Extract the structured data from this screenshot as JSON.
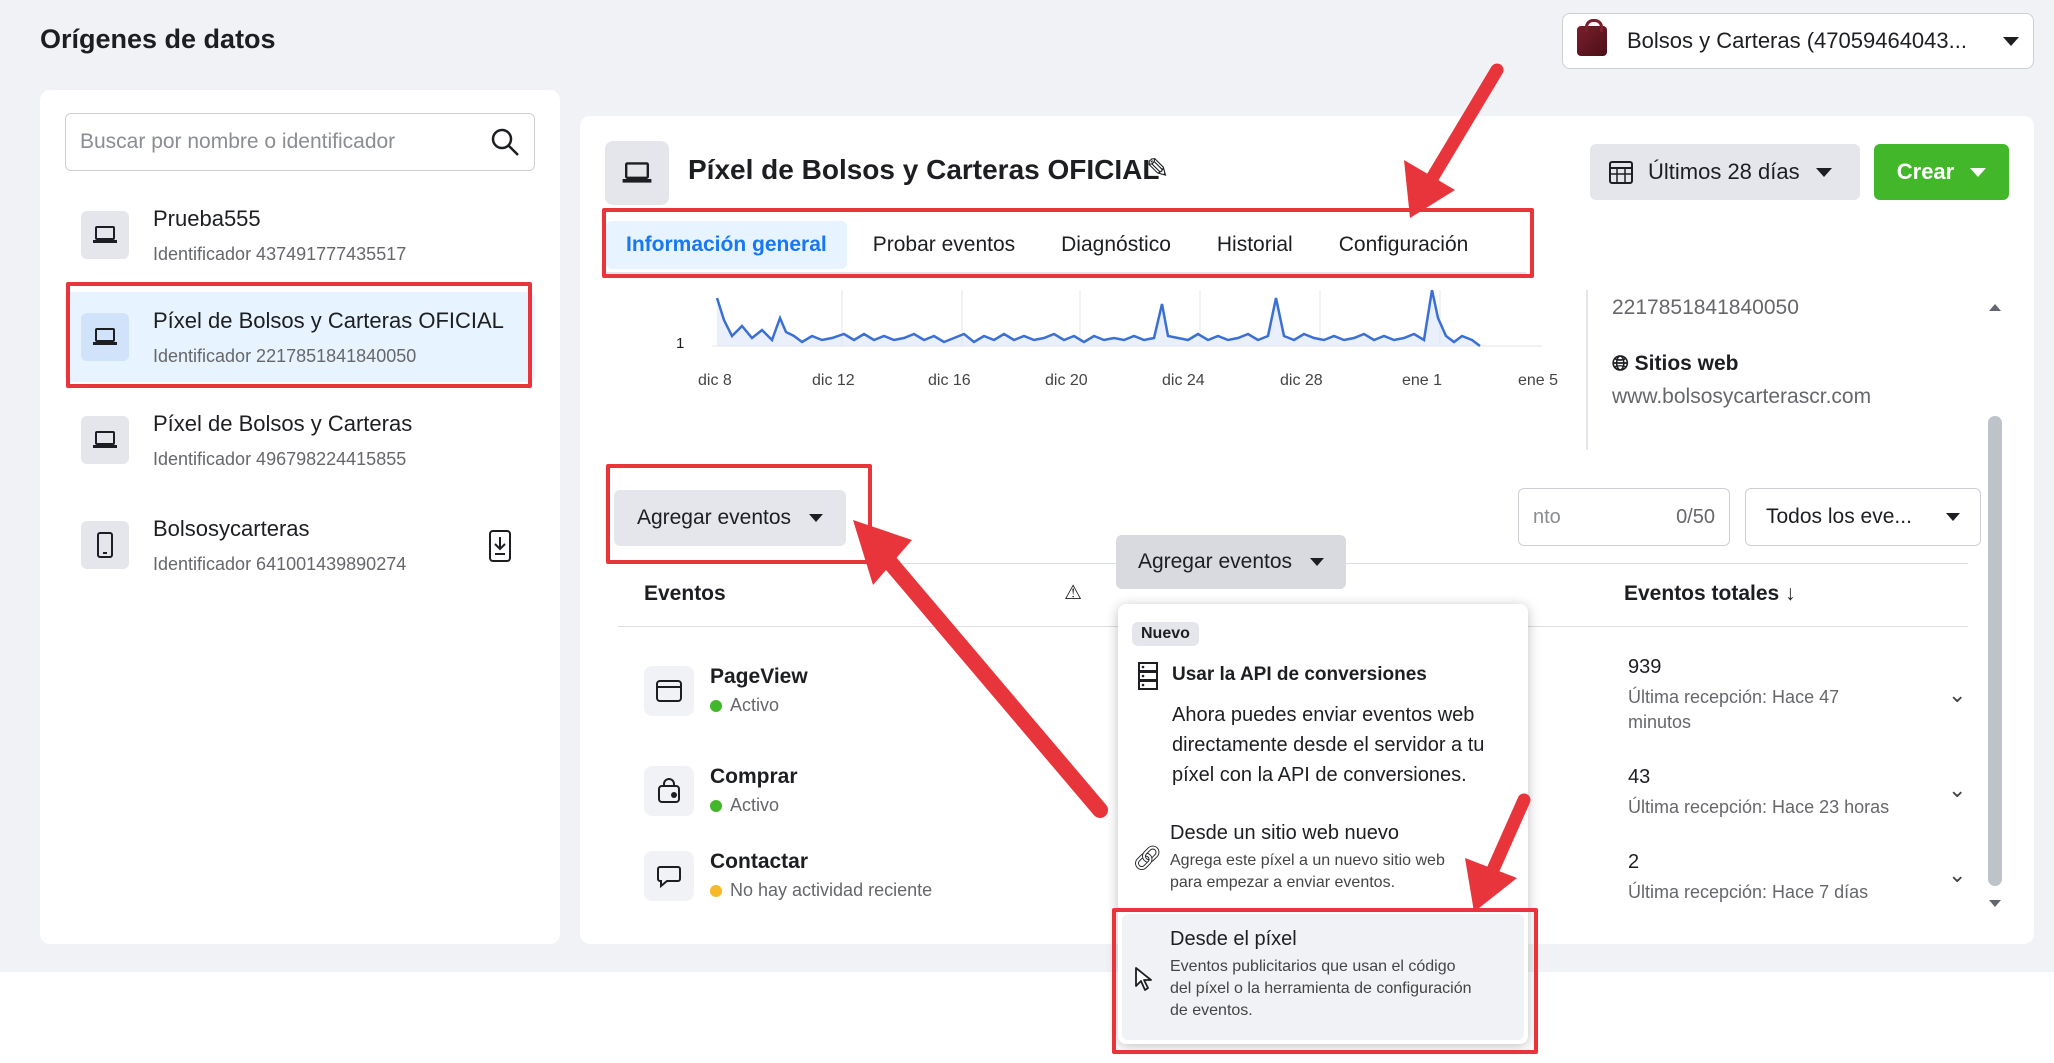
{
  "page": {
    "title": "Orígenes de datos"
  },
  "account": {
    "name": "Bolsos y Carteras (47059464043..."
  },
  "search": {
    "placeholder": "Buscar por nombre o identificador"
  },
  "sources": [
    {
      "name": "Prueba555",
      "id": "Identificador 437491777435517"
    },
    {
      "name": "Píxel de Bolsos y Carteras OFICIAL",
      "id": "Identificador 2217851841840050"
    },
    {
      "name": "Píxel de Bolsos y Carteras",
      "id": "Identificador 496798224415855"
    },
    {
      "name": "Bolsosycarteras",
      "id": "Identificador 641001439890274"
    }
  ],
  "pixel": {
    "title": "Píxel de Bolsos y Carteras OFICIAL",
    "id": "2217851841840050"
  },
  "toolbar": {
    "date_range": "Últimos 28 días",
    "create": "Crear"
  },
  "tabs": [
    {
      "label": "Información general"
    },
    {
      "label": "Probar eventos"
    },
    {
      "label": "Diagnóstico"
    },
    {
      "label": "Historial"
    },
    {
      "label": "Configuración"
    }
  ],
  "chart": {
    "ytick": "1",
    "xticks": [
      "dic 8",
      "dic 12",
      "dic 16",
      "dic 20",
      "dic 24",
      "dic 28",
      "ene 1",
      "ene 5"
    ]
  },
  "sites": {
    "heading": "Sitios web",
    "url": "www.bolsosycarterascr.com"
  },
  "events_toolbar": {
    "add_events": "Agregar eventos",
    "search_fragment": "nto",
    "counter": "0/50",
    "filter": "Todos los eve..."
  },
  "table": {
    "col_events": "Eventos",
    "col_total": "Eventos totales ↓"
  },
  "events": [
    {
      "name": "PageView",
      "status": "Activo",
      "status_color": "#42b72a",
      "total": "939",
      "last": "Última recepción: Hace 47 minutos"
    },
    {
      "name": "Comprar",
      "status": "Activo",
      "status_color": "#42b72a",
      "total": "43",
      "last": "Última recepción: Hace 23 horas"
    },
    {
      "name": "Contactar",
      "status": "No hay actividad reciente",
      "status_color": "#f7b928",
      "total": "2",
      "last": "Última recepción: Hace 7 días"
    }
  ],
  "dropdown": {
    "button": "Agregar eventos",
    "badge": "Nuevo",
    "api_title": "Usar la API de conversiones",
    "api_body": [
      "Ahora puedes enviar eventos web",
      "directamente desde el servidor a tu",
      "píxel con la API de conversiones."
    ],
    "website_title": "Desde un sitio web nuevo",
    "website_desc": [
      "Agrega este píxel a un nuevo sitio web",
      "para empezar a enviar eventos."
    ],
    "pixel_title": "Desde el píxel",
    "pixel_desc": [
      "Eventos publicitarios que usan el código",
      "del píxel o la herramienta de configuración",
      "de eventos."
    ]
  },
  "colors": {
    "accent": "#1877f2",
    "create": "#42b72a",
    "annotation": "#e8353b",
    "chart_line": "#3b6fd4"
  }
}
